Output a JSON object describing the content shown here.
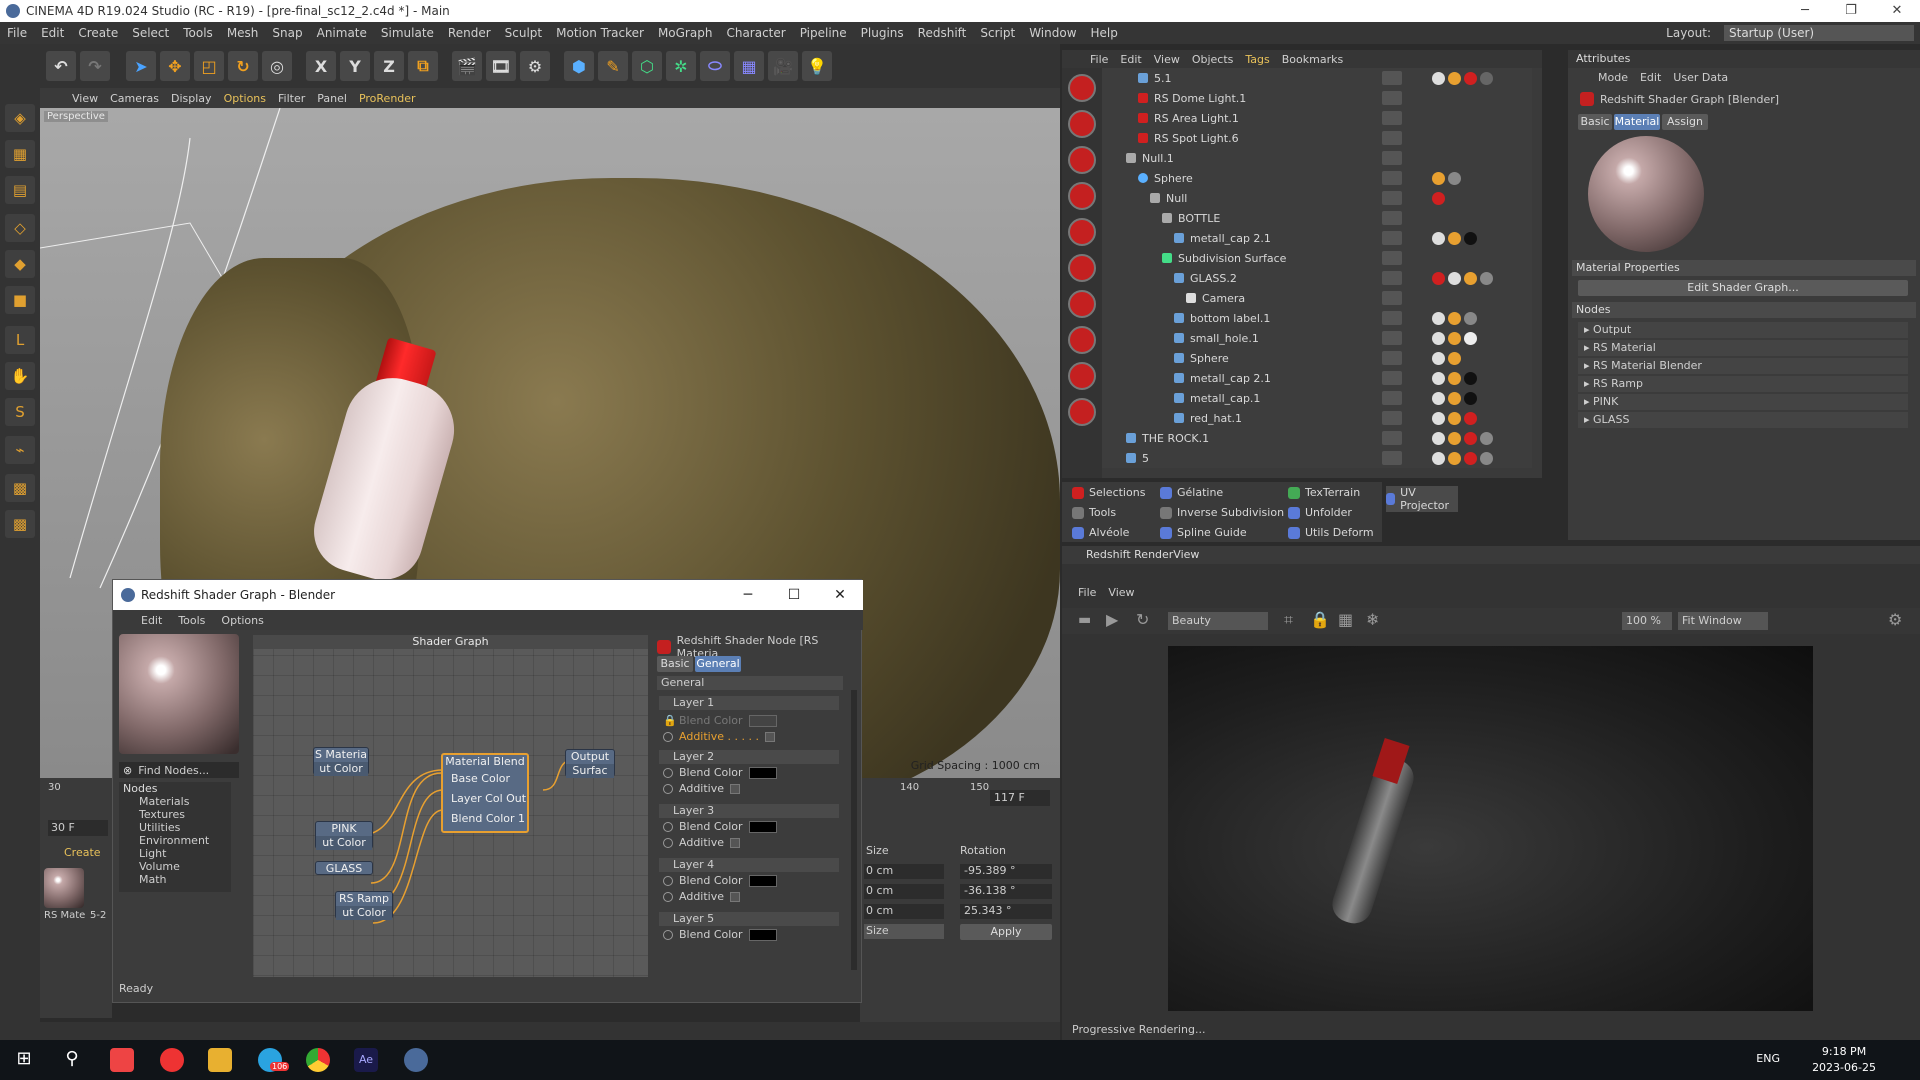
{
  "window": {
    "title": "CINEMA 4D R19.024 Studio (RC - R19) - [pre-final_sc12_2.c4d *] - Main"
  },
  "menubar": {
    "items": [
      "File",
      "Edit",
      "Create",
      "Select",
      "Tools",
      "Mesh",
      "Snap",
      "Animate",
      "Simulate",
      "Render",
      "Sculpt",
      "Motion Tracker",
      "MoGraph",
      "Character",
      "Pipeline",
      "Plugins",
      "Redshift",
      "Script",
      "Window",
      "Help"
    ],
    "layout_label": "Layout:",
    "layout_value": "Startup (User)"
  },
  "viewport": {
    "menu": [
      "View",
      "Cameras",
      "Display",
      "Options",
      "Filter",
      "Panel",
      "ProRender"
    ],
    "label": "Perspective",
    "grid_spacing": "Grid Spacing : 1000 cm"
  },
  "objects": {
    "menu": [
      "File",
      "Edit",
      "View",
      "Objects",
      "Tags",
      "Bookmarks"
    ],
    "rows": [
      "5.1",
      "RS Dome Light.1",
      "RS Area Light.1",
      "RS Spot Light.6",
      "Null.1",
      "Sphere",
      "Null",
      "BOTTLE",
      "metall_cap 2.1",
      "Subdivision Surface",
      "GLASS.2",
      "Camera",
      "bottom label.1",
      "small_hole.1",
      "Sphere",
      "metall_cap 2.1",
      "metall_cap.1",
      "red_hat.1",
      "THE ROCK.1",
      "5"
    ]
  },
  "plugins": {
    "items": [
      "Selections",
      "Gélatine",
      "TexTerrain",
      "UV Projector",
      "Tools",
      "Inverse Subdivision",
      "Unfolder",
      "Alvéole",
      "Spline Guide",
      "Utils Deform"
    ]
  },
  "attributes": {
    "header": "Attributes",
    "menu": [
      "Mode",
      "Edit",
      "User Data"
    ],
    "object_name": "Redshift Shader Graph [Blender]",
    "tabs": [
      "Basic",
      "Material",
      "Assign"
    ],
    "material_properties": "Material Properties",
    "edit_button": "Edit Shader Graph...",
    "nodes_label": "Nodes",
    "nodes": [
      "Output",
      "RS Material",
      "RS Material Blender",
      "RS Ramp",
      "PINK",
      "GLASS"
    ]
  },
  "renderview": {
    "header": "Redshift RenderView",
    "menu": [
      "File",
      "View"
    ],
    "aov": "Beauty",
    "zoom": "100 %",
    "fit": "Fit Window",
    "status": "Progressive Rendering..."
  },
  "dialog": {
    "title": "Redshift Shader Graph - Blender",
    "menu": [
      "Edit",
      "Tools",
      "Options"
    ],
    "find_nodes": "Find Nodes...",
    "nodes_header": "Nodes",
    "node_tree": [
      "Materials",
      "Textures",
      "Utilities",
      "Environment",
      "Light",
      "Volume",
      "Math"
    ],
    "graph_title": "Shader Graph",
    "graph_nodes": {
      "rs_material": "S Materia",
      "rs_material_port": "ut Color",
      "pink": "PINK",
      "pink_port": "ut Color",
      "glass": "GLASS",
      "rs_ramp": "RS Ramp",
      "rs_ramp_port": "ut Color",
      "blend_title": "Material Blend",
      "blend_ports": [
        "Base Color",
        "Layer Col  Out",
        "Blend Color 1"
      ],
      "output_title": "Output",
      "output_port": "Surfac"
    },
    "props_title": "Redshift Shader Node [RS Materia",
    "props_tabs": [
      "Basic",
      "General"
    ],
    "general_label": "General",
    "layers": [
      "Layer 1",
      "Layer 2",
      "Layer 3",
      "Layer 4",
      "Layer 5"
    ],
    "blend_color": "Blend Color",
    "additive": "Additive",
    "additive_dots": "Additive . . . . .",
    "status": "Ready"
  },
  "timeline": {
    "start": "30",
    "frame": "30 F",
    "ruler_140": "140",
    "ruler_150": "150",
    "end_frame": "117 F",
    "size_label": "Size",
    "rotation_label": "Rotation",
    "h": "-95.389 °",
    "p": "-36.138 °",
    "b": "25.343 °",
    "cm": "0 cm",
    "size_mode": "Size",
    "apply": "Apply",
    "create": "Create",
    "mat_label": "RS Mate",
    "mat_label2": "5-2"
  },
  "taskbar": {
    "lang": "ENG",
    "time": "9:18 PM",
    "date": "2023-06-25",
    "badge": "106"
  },
  "colors": {
    "accent": "#e8c15a",
    "selection": "#5b7fb5",
    "rs_red": "#c42020"
  }
}
